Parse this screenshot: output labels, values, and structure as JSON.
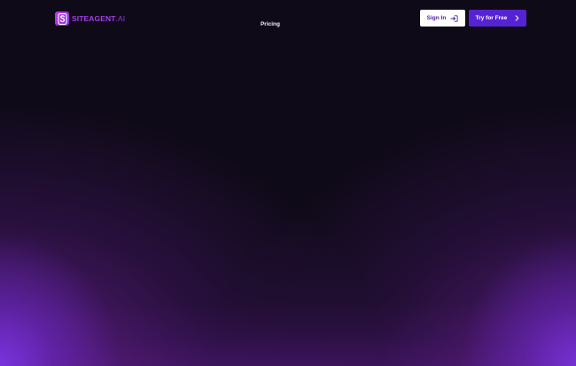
{
  "brand": {
    "name": "SITEAGENT",
    "suffix": ".AI",
    "logo_icon": "s-logo-icon",
    "accent_color": "#a23fe6"
  },
  "nav": {
    "links": [
      {
        "label": "Pricing"
      }
    ]
  },
  "actions": {
    "sign_in": {
      "label": "Sign In",
      "icon": "sign-in-icon",
      "background": "#ffffff",
      "text_color": "#4c1fb5"
    },
    "try_free": {
      "label": "Try for Free",
      "icon": "chevron-right-icon",
      "background": "#5623d4",
      "text_color": "#ffffff"
    }
  },
  "theme": {
    "background": "#0e0a17",
    "glow_color": "#7a34e1"
  }
}
